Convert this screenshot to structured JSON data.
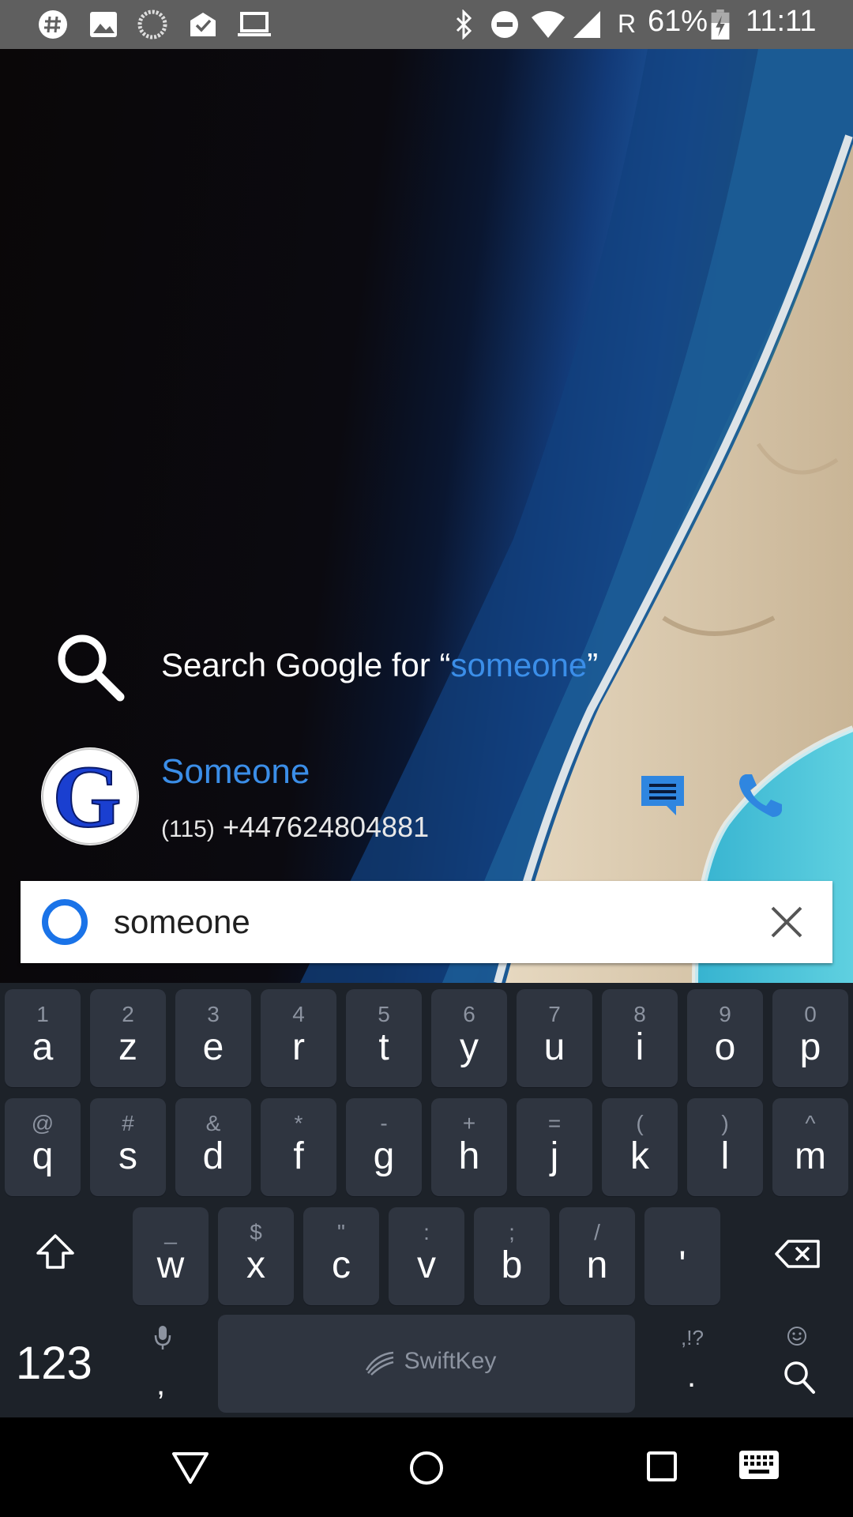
{
  "status_bar": {
    "time": "11:11",
    "battery": "61%",
    "roaming": "R",
    "icons": [
      "slack-icon",
      "image-icon",
      "loading-icon",
      "inbox-icon",
      "laptop-icon",
      "bluetooth-icon",
      "do-not-disturb-icon",
      "wifi-icon",
      "signal-icon",
      "battery-icon"
    ]
  },
  "suggestion": {
    "prefix": "Search Google for “",
    "query": "someone",
    "suffix": "”"
  },
  "contact": {
    "name": "Someone",
    "phone_label": "(115)",
    "phone_number": "+447624804881",
    "avatar_letter": "G"
  },
  "search_bar": {
    "value": "someone"
  },
  "keyboard": {
    "row1": [
      {
        "sub": "1",
        "main": "a"
      },
      {
        "sub": "2",
        "main": "z"
      },
      {
        "sub": "3",
        "main": "e"
      },
      {
        "sub": "4",
        "main": "r"
      },
      {
        "sub": "5",
        "main": "t"
      },
      {
        "sub": "6",
        "main": "y"
      },
      {
        "sub": "7",
        "main": "u"
      },
      {
        "sub": "8",
        "main": "i"
      },
      {
        "sub": "9",
        "main": "o"
      },
      {
        "sub": "0",
        "main": "p"
      }
    ],
    "row2": [
      {
        "sub": "@",
        "main": "q"
      },
      {
        "sub": "#",
        "main": "s"
      },
      {
        "sub": "&",
        "main": "d"
      },
      {
        "sub": "*",
        "main": "f"
      },
      {
        "sub": "-",
        "main": "g"
      },
      {
        "sub": "+",
        "main": "h"
      },
      {
        "sub": "=",
        "main": "j"
      },
      {
        "sub": "(",
        "main": "k"
      },
      {
        "sub": ")",
        "main": "l"
      },
      {
        "sub": "^",
        "main": "m"
      }
    ],
    "row3": [
      {
        "sub": "_",
        "main": "w"
      },
      {
        "sub": "$",
        "main": "x"
      },
      {
        "sub": "\"",
        "main": "c"
      },
      {
        "sub": ":",
        "main": "v"
      },
      {
        "sub": ";",
        "main": "b"
      },
      {
        "sub": "/",
        "main": "n"
      },
      {
        "sub": "",
        "main": "'"
      }
    ],
    "numbers_label": "123",
    "comma_label": ",",
    "space_label": "SwiftKey",
    "punct_sub": ",!?",
    "period_label": "."
  },
  "colors": {
    "accent": "#3b8ee8",
    "keyboard_bg": "#1d2229",
    "key_bg": "#2f3540",
    "status_bar": "#5f5f5f"
  }
}
